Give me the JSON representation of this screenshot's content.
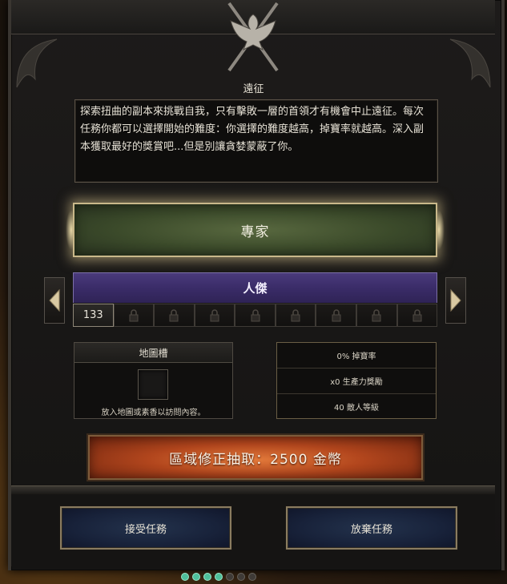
{
  "panel": {
    "title": "遠征",
    "description": "探索扭曲的副本來挑戰自我，只有擊敗一層的首領才有機會中止遠征。每次任務你都可以選擇開始的難度：你選擇的難度越高，掉寶率就越高。深入副本獲取最好的獎賞吧...但是別讓貪婪蒙蔽了你。"
  },
  "difficulty": {
    "label": "專家"
  },
  "tier": {
    "label": "人傑",
    "current_level": "133",
    "locked_slots": 8
  },
  "map_slot": {
    "header": "地圖槽",
    "hint": "放入地圖或素香以訪問內容。"
  },
  "stats": {
    "drop_rate": "0% 掉寶率",
    "productivity": "x0 生產力獎勵",
    "enemy_level": "40 敵人等級"
  },
  "reroll_button": {
    "label": "區域修正抽取：2500 金幣"
  },
  "actions": {
    "accept": "接受任務",
    "abandon": "放棄任務"
  },
  "page_dots": {
    "total": 7,
    "active": 4
  },
  "colors": {
    "difficulty_green": "#3b4a2a",
    "tier_purple": "#3a2c68",
    "reroll_orange": "#b2461d",
    "button_navy": "#18223a",
    "gold_border": "#c9b88a"
  }
}
